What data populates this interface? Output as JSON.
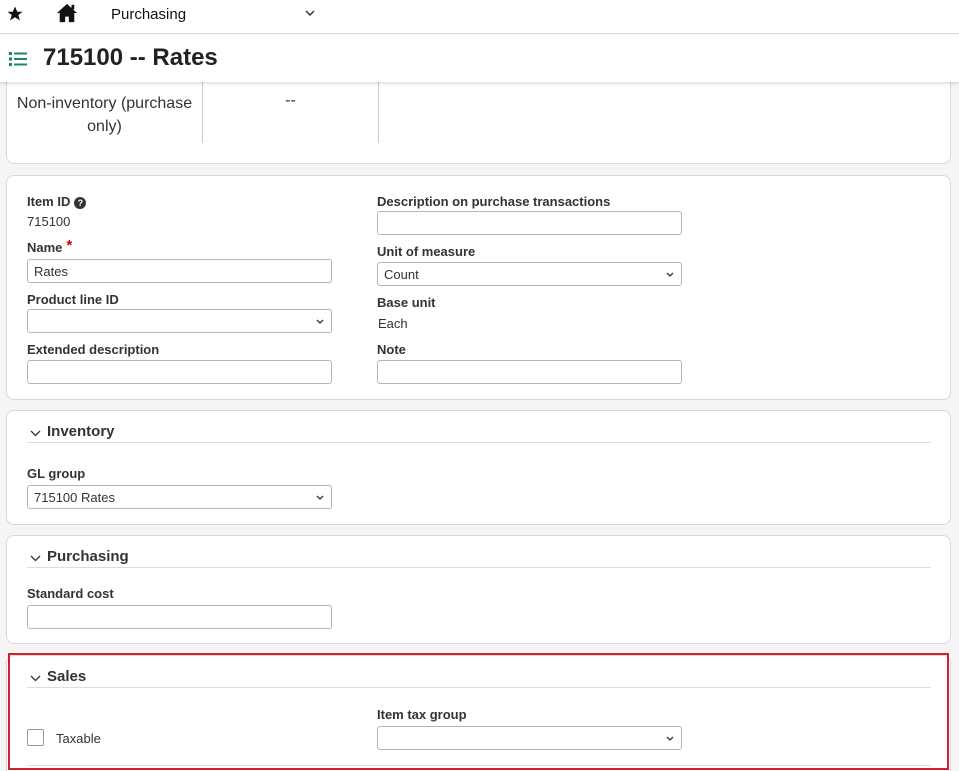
{
  "topbar": {
    "module": "Purchasing"
  },
  "page": {
    "title": "715100 -- Rates"
  },
  "summary": {
    "item_type": "Non-inventory (purchase only)",
    "second_value": "--"
  },
  "details": {
    "item_id_label": "Item ID",
    "item_id_value": "715100",
    "name_label": "Name",
    "name_value": "Rates",
    "product_line_label": "Product line ID",
    "product_line_value": "",
    "ext_desc_label": "Extended description",
    "ext_desc_value": "",
    "desc_purchase_label": "Description on purchase transactions",
    "desc_purchase_value": "",
    "uom_label": "Unit of measure",
    "uom_value": "Count",
    "base_unit_label": "Base unit",
    "base_unit_value": "Each",
    "note_label": "Note",
    "note_value": ""
  },
  "inventory": {
    "title": "Inventory",
    "gl_group_label": "GL group",
    "gl_group_value": "715100 Rates"
  },
  "purchasing": {
    "title": "Purchasing",
    "standard_cost_label": "Standard cost",
    "standard_cost_value": ""
  },
  "sales": {
    "title": "Sales",
    "taxable_label": "Taxable",
    "taxable_checked": false,
    "item_tax_group_label": "Item tax group",
    "item_tax_group_value": ""
  },
  "colors": {
    "accent": "#1a8a5a",
    "highlight": "#d0202e"
  }
}
